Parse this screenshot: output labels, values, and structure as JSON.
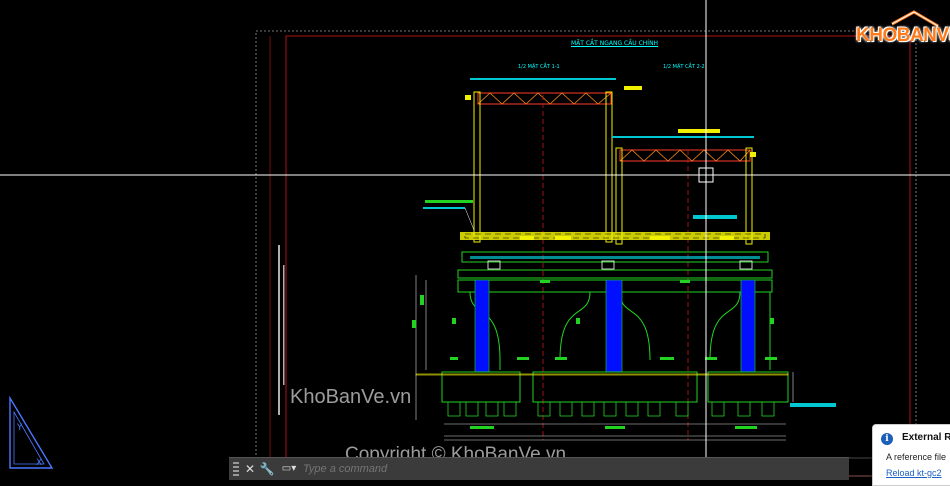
{
  "drawing": {
    "title": "MẶT CẮT NGANG CẦU CHÍNH",
    "left_section_label": "1/2 MẶT CẮT 1-1",
    "right_section_label": "1/2 MẶT CẮT 2-2"
  },
  "watermarks": {
    "brand": "KhoBanVe.vn",
    "copyright": "Copyright © KhoBanVe.vn"
  },
  "logo": {
    "text": "KHOBANVE"
  },
  "command_line": {
    "placeholder": "Type a command"
  },
  "notification": {
    "title": "External R",
    "message": "A reference file",
    "link": "Reload kt-gc2"
  },
  "colors": {
    "background": "#000000",
    "accent_yellow": "#f0f000",
    "structure_green": "#22d322",
    "pier_blue": "#0010ff",
    "border_red": "#c41818",
    "crosshair": "#ffffff",
    "logo_orange": "#ff7a1a"
  }
}
